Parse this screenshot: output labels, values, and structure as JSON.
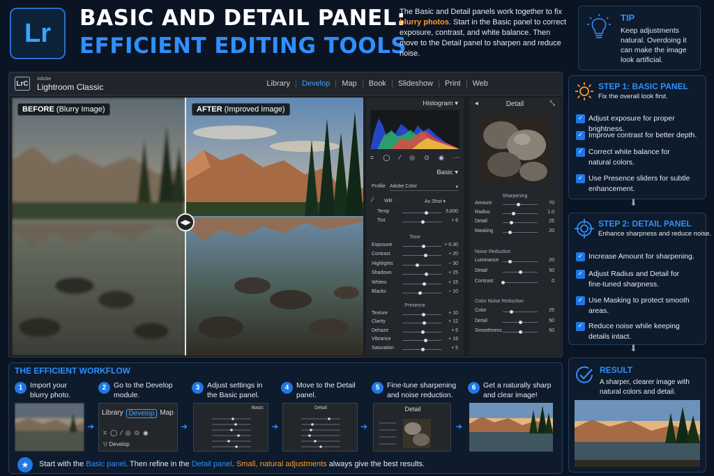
{
  "header": {
    "logo": "Lr",
    "title_line1": "BASIC AND DETAIL PANEL:",
    "title_line2": "EFFICIENT EDITING TOOLS",
    "intro": {
      "p1": "The Basic and Detail panels work together to fix ",
      "highlight": "blurry photos",
      "p2": ". Start in the Basic panel to correct exposure, contrast, and white balance. Then move to the Detail panel to sharpen and reduce noise."
    }
  },
  "tip": {
    "title": "TIP",
    "text": "Keep adjustments natural. Overdoing it can make the image look artificial.",
    "icon": "lightbulb-icon"
  },
  "lightroom": {
    "badge": "LrC",
    "vendor": "Adobe",
    "app_name": "Lightroom Classic",
    "modules": [
      "Library",
      "Develop",
      "Map",
      "Book",
      "Slideshow",
      "Print",
      "Web"
    ],
    "active_module": "Develop",
    "before_label_bold": "BEFORE",
    "before_label_rest": " (Blurry Image)",
    "after_label_bold": "AFTER",
    "after_label_rest": " (Improved Image)",
    "histogram_label": "Histogram",
    "basic_label": "Basic",
    "profile_label": "Profile",
    "profile_value": "Adobe Color",
    "wb_label": "WB :",
    "wb_value": "As Shot",
    "wb_sliders": [
      {
        "label": "Temp",
        "value": "5,600",
        "pos": 0.62
      },
      {
        "label": "Tint",
        "value": "+ 6",
        "pos": 0.52
      }
    ],
    "tone_label": "Tone",
    "tone_sliders": [
      {
        "label": "Exposure",
        "value": "+ 0.30",
        "pos": 0.55
      },
      {
        "label": "Contrast",
        "value": "+ 20",
        "pos": 0.6
      },
      {
        "label": "Highlights",
        "value": "− 30",
        "pos": 0.38
      },
      {
        "label": "Shadows",
        "value": "+ 25",
        "pos": 0.62
      },
      {
        "label": "Whites",
        "value": "+ 15",
        "pos": 0.57
      },
      {
        "label": "Blacks",
        "value": "− 10",
        "pos": 0.45
      }
    ],
    "presence_label": "Presence",
    "presence_sliders": [
      {
        "label": "Texture",
        "value": "+ 10",
        "pos": 0.55
      },
      {
        "label": "Clarity",
        "value": "+ 12",
        "pos": 0.56
      },
      {
        "label": "Dehaze",
        "value": "+ 5",
        "pos": 0.52
      },
      {
        "label": "Vibrance",
        "value": "+ 18",
        "pos": 0.59
      },
      {
        "label": "Saturation",
        "value": "+ 5",
        "pos": 0.52
      }
    ],
    "detail_label": "Detail",
    "sharpening_label": "Sharpening",
    "sharpening_sliders": [
      {
        "label": "Amount",
        "value": "70",
        "pos": 0.45
      },
      {
        "label": "Radius",
        "value": "1.0",
        "pos": 0.3
      },
      {
        "label": "Detail",
        "value": "25",
        "pos": 0.25
      },
      {
        "label": "Masking",
        "value": "20",
        "pos": 0.2
      }
    ],
    "noise_label": "Noise Reduction",
    "noise_sliders": [
      {
        "label": "Luminance",
        "value": "20",
        "pos": 0.2
      },
      {
        "label": "Detail",
        "value": "50",
        "pos": 0.5
      },
      {
        "label": "Contrast",
        "value": "0",
        "pos": 0.0
      }
    ],
    "color_noise_label": "Color Noise Reduction",
    "color_noise_sliders": [
      {
        "label": "Color",
        "value": "25",
        "pos": 0.25
      },
      {
        "label": "Detail",
        "value": "50",
        "pos": 0.5
      },
      {
        "label": "Smoothness",
        "value": "50",
        "pos": 0.5
      }
    ]
  },
  "step1": {
    "title": "STEP 1: BASIC PANEL",
    "subtitle": "Fix the overall look first.",
    "items": [
      "Adjust exposure for proper brightness.",
      "Improve contrast for better depth.",
      "Correct white balance for natural colors.",
      "Use Presence sliders for subtle enhancement."
    ]
  },
  "step2": {
    "title": "STEP 2: DETAIL PANEL",
    "subtitle": "Enhance sharpness and reduce noise.",
    "items": [
      "Increase Amount for sharpening.",
      "Adjust Radius and Detail for fine-tuned sharpness.",
      "Use Masking to protect smooth areas.",
      "Reduce noise while keeping details intact."
    ]
  },
  "result": {
    "title": "RESULT",
    "text": "A sharper, clearer image with natural colors and detail."
  },
  "workflow": {
    "title": "THE EFFICIENT WORKFLOW",
    "steps": [
      {
        "num": "1",
        "line1": "Import your",
        "line2": "blurry photo."
      },
      {
        "num": "2",
        "line1": "Go to the Develop",
        "line2": "module."
      },
      {
        "num": "3",
        "line1": "Adjust settings in",
        "line2": "the Basic panel."
      },
      {
        "num": "4",
        "line1": "Move to the Detail",
        "line2": "panel."
      },
      {
        "num": "5",
        "line1": "Fine-tune sharpening",
        "line2": "and noise reduction."
      },
      {
        "num": "6",
        "line1": "Get a naturally sharp",
        "line2": "and clear image!"
      }
    ],
    "mini_modules": [
      "Library",
      "Develop",
      "Map"
    ],
    "mini_develop_label": "Develop",
    "mini_basic_label": "Basic",
    "mini_detail_label": "Detail"
  },
  "footer": {
    "a": "Start with the ",
    "b": "Basic panel",
    "c": ". Then refine in the ",
    "d": "Detail panel",
    "e": ". ",
    "f": "Small, natural adjustments",
    "g": " always give the best results."
  },
  "colors": {
    "accent": "#2f8fff",
    "highlight": "#ff9a2e",
    "background": "#0a1422"
  }
}
